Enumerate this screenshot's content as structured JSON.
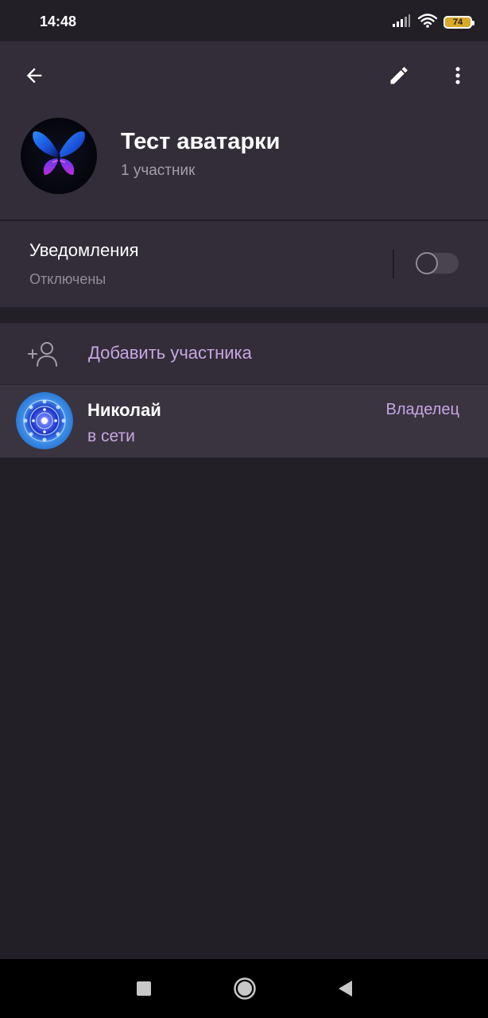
{
  "status_bar": {
    "time": "14:48",
    "battery": "74",
    "icons": [
      "signal-icon",
      "wifi-icon",
      "battery-icon"
    ]
  },
  "header": {
    "icons": [
      "back-arrow-icon",
      "pencil-icon",
      "more-vert-icon"
    ],
    "group_title": "Тест аватарки",
    "group_subtitle": "1 участник"
  },
  "notifications": {
    "title": "Уведомления",
    "status": "Отключены",
    "enabled": false
  },
  "add_member": {
    "icon": "add-person-icon",
    "label": "Добавить участника"
  },
  "members": [
    {
      "name": "Николай",
      "status": "в сети",
      "role": "Владелец"
    }
  ],
  "nav_bar": {
    "icons": [
      "recents-square-icon",
      "home-circle-icon",
      "back-triangle-icon"
    ]
  },
  "colors": {
    "background": "#221f27",
    "surface": "#322d39",
    "accent": "#c7a6e0",
    "secondary_text": "#a39ea9"
  }
}
